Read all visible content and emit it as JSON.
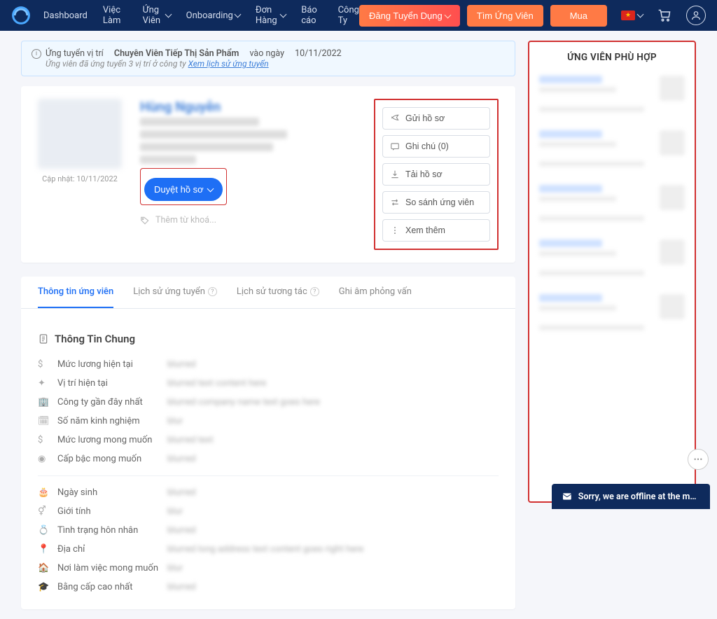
{
  "nav": {
    "items": [
      "Dashboard",
      "Việc Làm",
      "Ứng Viên",
      "Onboarding",
      "Đơn Hàng",
      "Báo cáo",
      "Công Ty"
    ],
    "post_job": "Đăng Tuyển Dụng",
    "find_candidate": "Tìm Ứng Viên",
    "buy": "Mua"
  },
  "alert": {
    "prefix": "Ứng tuyển vị trí",
    "position": "Chuyên Viên Tiếp Thị Sản Phẩm",
    "date_prefix": "vào ngày",
    "date": "10/11/2022",
    "sub": "Ứng viên đã ứng tuyển 3 vị trí ở công ty",
    "link": "Xem lịch sử ứng tuyển"
  },
  "profile": {
    "name": "Hùng Nguyễn",
    "updated_label": "Cập nhật:",
    "updated_date": "10/11/2022",
    "approve": "Duyệt hồ sơ",
    "add_keyword": "Thêm từ khoá..."
  },
  "actions": {
    "send": "Gửi hồ sơ",
    "note": "Ghi chú (0)",
    "download": "Tải hồ sơ",
    "compare": "So sánh ứng viên",
    "more": "Xem thêm"
  },
  "tabs": {
    "info": "Thông tin ứng viên",
    "history": "Lịch sử ứng tuyển",
    "interaction": "Lịch sử tương tác",
    "recording": "Ghi âm phỏng vấn"
  },
  "section": {
    "general": "Thông Tin Chung"
  },
  "fields": {
    "current_salary": "Mức lương hiện tại",
    "current_position": "Vị trí hiện tại",
    "recent_company": "Công ty gần đây nhất",
    "experience": "Số năm kinh nghiệm",
    "desired_salary": "Mức lương mong muốn",
    "desired_level": "Cấp bậc mong muốn",
    "dob": "Ngày sinh",
    "gender": "Giới tính",
    "marital": "Tình trạng hôn nhân",
    "address": "Địa chỉ",
    "workplace": "Nơi làm việc mong muốn",
    "education": "Bằng cấp cao nhất"
  },
  "matching": {
    "title": "ỨNG VIÊN PHÙ HỢP"
  },
  "chat": {
    "status": "Sorry, we are offline at the mo..."
  }
}
